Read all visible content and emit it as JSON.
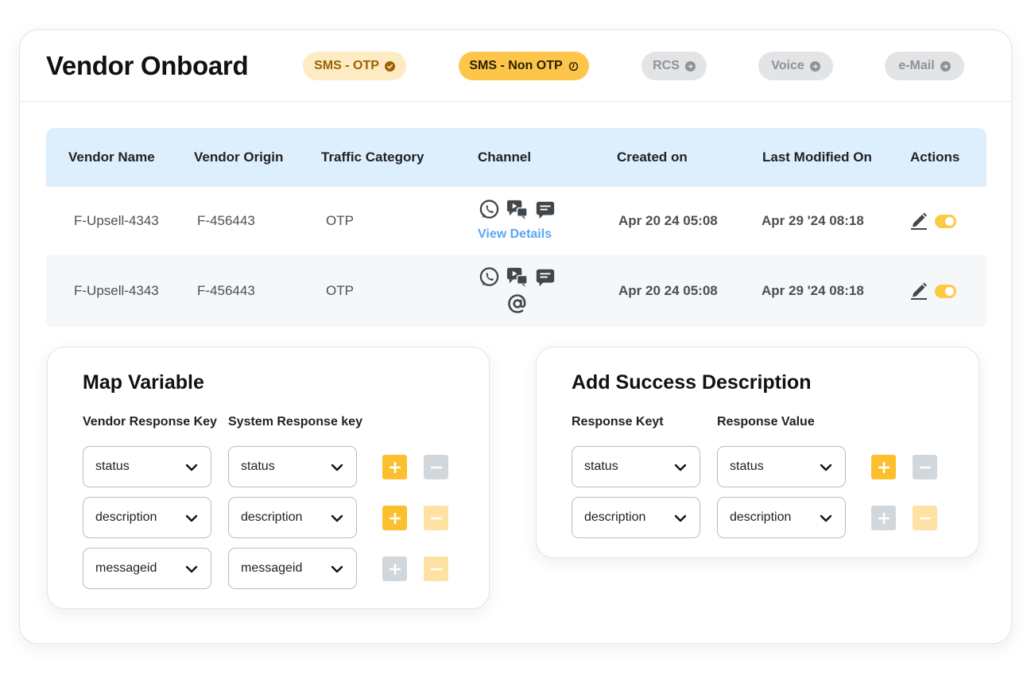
{
  "header": {
    "title": "Vendor Onboard",
    "tabs": [
      {
        "label": "SMS - OTP",
        "state": "completed",
        "icon": "check-circle-icon"
      },
      {
        "label": "SMS - Non OTP",
        "state": "active",
        "icon": "timer-icon"
      },
      {
        "label": "RCS",
        "state": "pending",
        "icon": "arrow-right-circle-icon"
      },
      {
        "label": "Voice",
        "state": "pending",
        "icon": "arrow-right-circle-icon"
      },
      {
        "label": "e-Mail",
        "state": "pending",
        "icon": "arrow-right-circle-icon"
      }
    ]
  },
  "table": {
    "columns": [
      "Vendor Name",
      "Vendor Origin",
      "Traffic Category",
      "Channel",
      "Created on",
      "Last Modified On",
      "Actions"
    ],
    "rows": [
      {
        "vendor_name": "F-Upsell-4343",
        "vendor_origin": "F-456443",
        "traffic_category": "OTP",
        "channel_icons": [
          "whatsapp-icon",
          "rcs-chat-icon",
          "sms-icon"
        ],
        "channel_link": "View Details",
        "created_on": "Apr 20 24 05:08",
        "last_modified_on": "Apr 29 '24 08:18",
        "enabled": true
      },
      {
        "vendor_name": "F-Upsell-4343",
        "vendor_origin": "F-456443",
        "traffic_category": "OTP",
        "channel_icons": [
          "whatsapp-icon",
          "rcs-chat-icon",
          "sms-icon",
          "email-at-icon"
        ],
        "created_on": "Apr 20 24 05:08",
        "last_modified_on": "Apr 29 '24 08:18",
        "enabled": true
      }
    ]
  },
  "map_variable": {
    "title": "Map Variable",
    "col1_label": "Vendor Response Key",
    "col2_label": "System Response key",
    "rows": [
      {
        "vendor_key": "status",
        "system_key": "status",
        "add_enabled": true,
        "remove_enabled": false
      },
      {
        "vendor_key": "description",
        "system_key": "description",
        "add_enabled": true,
        "remove_enabled": true
      },
      {
        "vendor_key": "messageid",
        "system_key": "messageid",
        "add_enabled": false,
        "remove_enabled": true
      }
    ]
  },
  "success_description": {
    "title": "Add Success Description",
    "col1_label": "Response Keyt",
    "col2_label": "Response Value",
    "rows": [
      {
        "response_key": "status",
        "response_value": "status",
        "add_enabled": true,
        "remove_enabled": false
      },
      {
        "response_key": "description",
        "response_value": "description",
        "add_enabled": false,
        "remove_enabled": true
      }
    ]
  },
  "colors": {
    "accent": "#fcc02f",
    "table_header_bg": "#ddeefc",
    "link": "#5aa7f0",
    "tab_done_bg": "#fdebc4",
    "tab_active_bg": "#fdc54a",
    "tab_pending_bg": "#e2e4e6"
  }
}
